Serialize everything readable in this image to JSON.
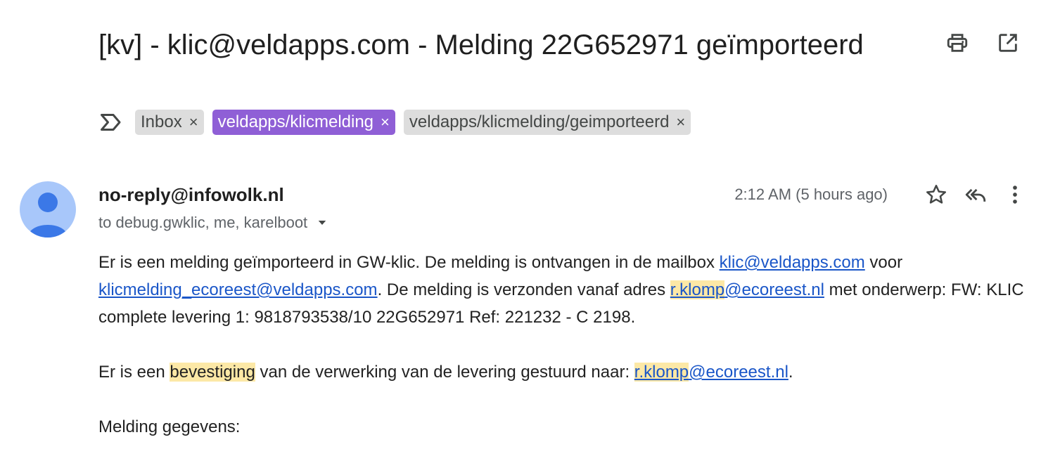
{
  "email": {
    "subject": "[kv] - klic@veldapps.com - Melding 22G652971 geïmporteerd",
    "labels": [
      {
        "name": "Inbox",
        "color": "#dddddd"
      },
      {
        "name": "veldapps/klicmelding",
        "color": "#8f5fd6"
      },
      {
        "name": "veldapps/klicmelding/geimporteerd",
        "color": "#dddddd"
      }
    ],
    "remove_label_glyph": "×",
    "sender": "no-reply@infowolk.nl",
    "recipients": "to debug.gwklic, me, karelboot",
    "timestamp": "2:12 AM (5 hours ago)"
  },
  "actions": {
    "print": "printer-icon",
    "open_new_window": "open-in-new-icon",
    "star": "star-icon",
    "reply_all": "reply-all-icon",
    "more": "more-vert-icon"
  },
  "body": {
    "p1": {
      "t1": "Er is een melding geïmporteerd in GW-klic. De melding is ontvangen in de mailbox ",
      "link1": "klic@veldapps.com",
      "t2": " voor ",
      "link2": "klicmelding_ecoreest@veldapps.com",
      "t3": ". De melding is verzonden vanaf adres ",
      "link3_hl": "r.klomp",
      "link3_rest": "@ecoreest.nl",
      "t4": " met onderwerp: FW: KLIC complete levering 1: 9818793538/10 22G652971 Ref: 221232 - C 2198."
    },
    "p2": {
      "t1": "Er is een ",
      "highlight": "bevestiging",
      "t2": " van de verwerking van de levering gestuurd naar: ",
      "link_hl": "r.klomp",
      "link_rest": "@ecoreest.nl",
      "t3": "."
    },
    "p3": "Melding gegevens:"
  },
  "colors": {
    "link": "#1a56c8",
    "highlight": "#fce8a6",
    "avatar": "#a8c7fa",
    "avatar_figure": "#3b78e7"
  }
}
